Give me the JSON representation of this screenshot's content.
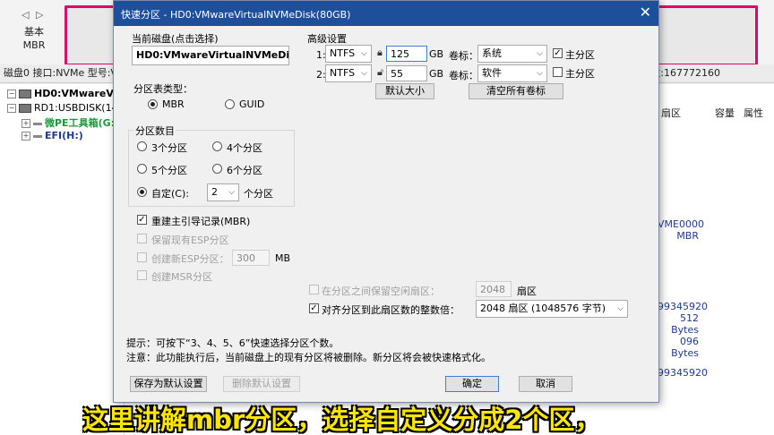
{
  "background": {
    "nav_arrows": "◁ ▷",
    "disk_kind_line1": "基本",
    "disk_kind_line2": "MBR",
    "disk_info": "磁盘0 接口:NVMe  型号:VM",
    "disk_info_right": "数:167772160",
    "tree": [
      {
        "label": "HD0:VMwareVir",
        "color": "#000000",
        "bold": true
      },
      {
        "label": "RD1:USBDISK(14",
        "color": "#000000",
        "bold": false
      },
      {
        "label": "微PE工具箱(G:",
        "color": "#1a9a3a",
        "bold": true
      },
      {
        "label": "EFI(H:)",
        "color": "#1f3a8f",
        "bold": true
      }
    ],
    "col_sector": "扇区",
    "col_capacity": "容量",
    "col_attr": "属性",
    "right_lines_a": [
      "VME0000",
      "MBR"
    ],
    "right_lines_b": [
      "99345920",
      "512 Bytes",
      "096 Bytes"
    ],
    "right_lines_c": [
      "99345920"
    ]
  },
  "dialog": {
    "title": "快速分区 - HD0:VMwareVirtualNVMeDisk(80GB)",
    "close_glyph": "✕",
    "current_disk_legend": "当前磁盘(点击选择)",
    "current_disk_value": "HD0:VMwareVirtualNVMeDisk",
    "partition_table_legend": "分区表类型：",
    "mbr_label": "MBR",
    "guid_label": "GUID",
    "partition_count_legend": "分区数目",
    "count_options": [
      "3个分区",
      "4个分区",
      "5个分区",
      "6个分区"
    ],
    "custom_label": "自定(C):",
    "custom_value": "2",
    "custom_suffix": "个分区",
    "rebuild_mbr": "重建主引导记录(MBR)",
    "keep_esp": "保留现有ESP分区",
    "create_esp": "创建新ESP分区：",
    "esp_size": "300",
    "esp_unit": "MB",
    "create_msr": "创建MSR分区",
    "advanced_legend": "高级设置",
    "rows": [
      {
        "index": "1:",
        "fs": "NTFS",
        "size": "125",
        "unit": "GB",
        "vol_label": "卷标：",
        "vol": "系统",
        "primary": "主分区",
        "primary_checked": true
      },
      {
        "index": "2:",
        "fs": "NTFS",
        "size": "55",
        "unit": "GB",
        "vol_label": "卷标：",
        "vol": "软件",
        "primary": "主分区",
        "primary_checked": false
      }
    ],
    "default_size_btn": "默认大小",
    "clear_labels_btn": "清空所有卷标",
    "reserve_free": "在分区之间保留空闲扇区：",
    "reserve_value": "2048",
    "reserve_unit": "扇区",
    "align_label": "对齐分区到此扇区数的整数倍：",
    "align_value": "2048 扇区 (1048576 字节)",
    "tip1": "提示：可按下“3、4、5、6”快速选择分区个数。",
    "tip2": "注意：此功能执行后，当前磁盘上的现有分区将被删除。新分区将会被快速格式化。",
    "save_default_btn": "保存为默认设置",
    "delete_default_btn": "删除默认设置",
    "ok_btn": "确定",
    "cancel_btn": "取消"
  },
  "subtitle": "这里讲解mbr分区，选择自定义分成2个区，",
  "colors": {
    "titlebar": "#1e4f9a",
    "disk_bar_border": "#e0006e",
    "subtitle": "#ffe600"
  }
}
